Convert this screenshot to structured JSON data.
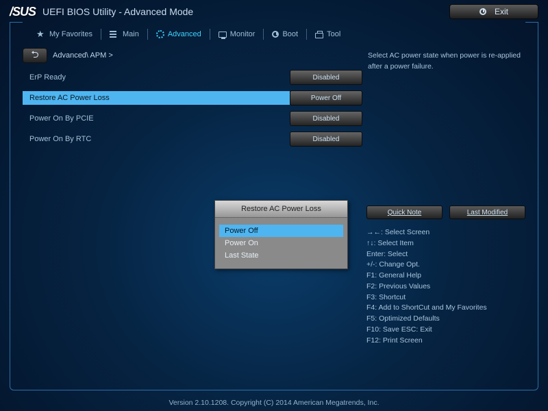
{
  "header": {
    "logo": "/SUS",
    "title": "UEFI BIOS Utility - Advanced Mode",
    "exit": "Exit"
  },
  "tabs": [
    {
      "label": "My Favorites"
    },
    {
      "label": "Main"
    },
    {
      "label": "Advanced"
    },
    {
      "label": "Monitor"
    },
    {
      "label": "Boot"
    },
    {
      "label": "Tool"
    }
  ],
  "breadcrumb": "Advanced\\ APM >",
  "settings": [
    {
      "label": "ErP Ready",
      "value": "Disabled"
    },
    {
      "label": "Restore AC Power Loss",
      "value": "Power Off"
    },
    {
      "label": "Power On By PCIE",
      "value": "Disabled"
    },
    {
      "label": "Power On By RTC",
      "value": "Disabled"
    }
  ],
  "popup": {
    "title": "Restore AC Power Loss",
    "options": [
      "Power Off",
      "Power On",
      "Last State"
    ]
  },
  "help_text": "Select AC power state when power is re-applied after a power failure.",
  "buttons": {
    "quick_note": "Quick Note",
    "last_modified": "Last Modified"
  },
  "hints": [
    "→←: Select Screen",
    "↑↓: Select Item",
    "Enter: Select",
    "+/-: Change Opt.",
    "F1: General Help",
    "F2: Previous Values",
    "F3: Shortcut",
    "F4: Add to ShortCut and My Favorites",
    "F5: Optimized Defaults",
    "F10: Save  ESC: Exit",
    "F12: Print Screen"
  ],
  "footer": "Version 2.10.1208. Copyright (C) 2014 American Megatrends, Inc."
}
